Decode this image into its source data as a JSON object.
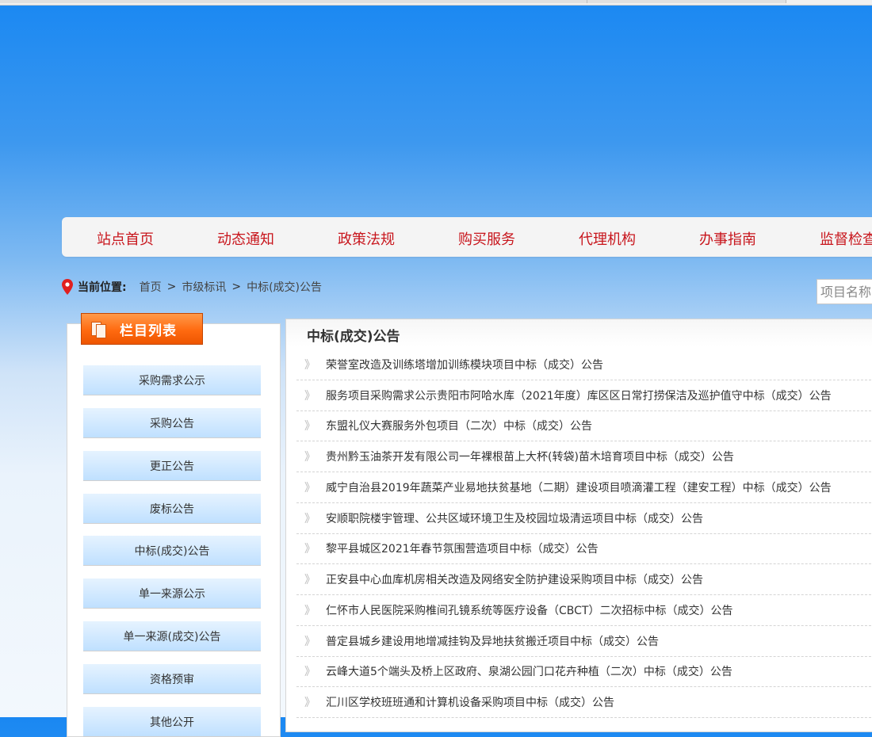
{
  "nav": {
    "items": [
      {
        "label": "站点首页"
      },
      {
        "label": "动态通知"
      },
      {
        "label": "政策法规"
      },
      {
        "label": "购买服务"
      },
      {
        "label": "代理机构"
      },
      {
        "label": "办事指南"
      },
      {
        "label": "监督检查"
      }
    ]
  },
  "location": {
    "label": "当前位置:",
    "crumbs": [
      "首页",
      "市级标讯",
      "中标(成交)公告"
    ],
    "separator": ">"
  },
  "search": {
    "placeholder": "项目名称"
  },
  "sidebar": {
    "title": "栏目列表",
    "items": [
      {
        "label": "采购需求公示"
      },
      {
        "label": "采购公告"
      },
      {
        "label": "更正公告"
      },
      {
        "label": "废标公告"
      },
      {
        "label": "中标(成交)公告"
      },
      {
        "label": "单一来源公示"
      },
      {
        "label": "单一来源(成交)公告"
      },
      {
        "label": "资格预审"
      },
      {
        "label": "其他公开"
      }
    ]
  },
  "main": {
    "title": "中标(成交)公告",
    "arrow": "》",
    "rows": [
      {
        "title": "荣誉室改造及训练塔增加训练模块项目中标（成交）公告"
      },
      {
        "title": "服务项目采购需求公示贵阳市阿哈水库（2021年度）库区区日常打捞保洁及巡护值守中标（成交）公告"
      },
      {
        "title": "东盟礼仪大赛服务外包项目（二次）中标（成交）公告"
      },
      {
        "title": "贵州黔玉油茶开发有限公司一年裸根苗上大杯(转袋)苗木培育项目中标（成交）公告"
      },
      {
        "title": "威宁自治县2019年蔬菜产业易地扶贫基地（二期）建设项目喷滴灌工程（建安工程）中标（成交）公告"
      },
      {
        "title": "安顺职院楼宇管理、公共区域环境卫生及校园垃圾清运项目中标（成交）公告"
      },
      {
        "title": "黎平县城区2021年春节氛围营造项目中标（成交）公告"
      },
      {
        "title": "正安县中心血库机房相关改造及网络安全防护建设采购项目中标（成交）公告"
      },
      {
        "title": "仁怀市人民医院采购椎间孔镜系统等医疗设备（CBCT）二次招标中标（成交）公告"
      },
      {
        "title": "普定县城乡建设用地增减挂钩及异地扶贫搬迁项目中标（成交）公告"
      },
      {
        "title": "云峰大道5个端头及桥上区政府、泉湖公园门口花卉种植（二次）中标（成交）公告"
      },
      {
        "title": "汇川区学校班班通和计算机设备采购项目中标（成交）公告"
      }
    ]
  }
}
